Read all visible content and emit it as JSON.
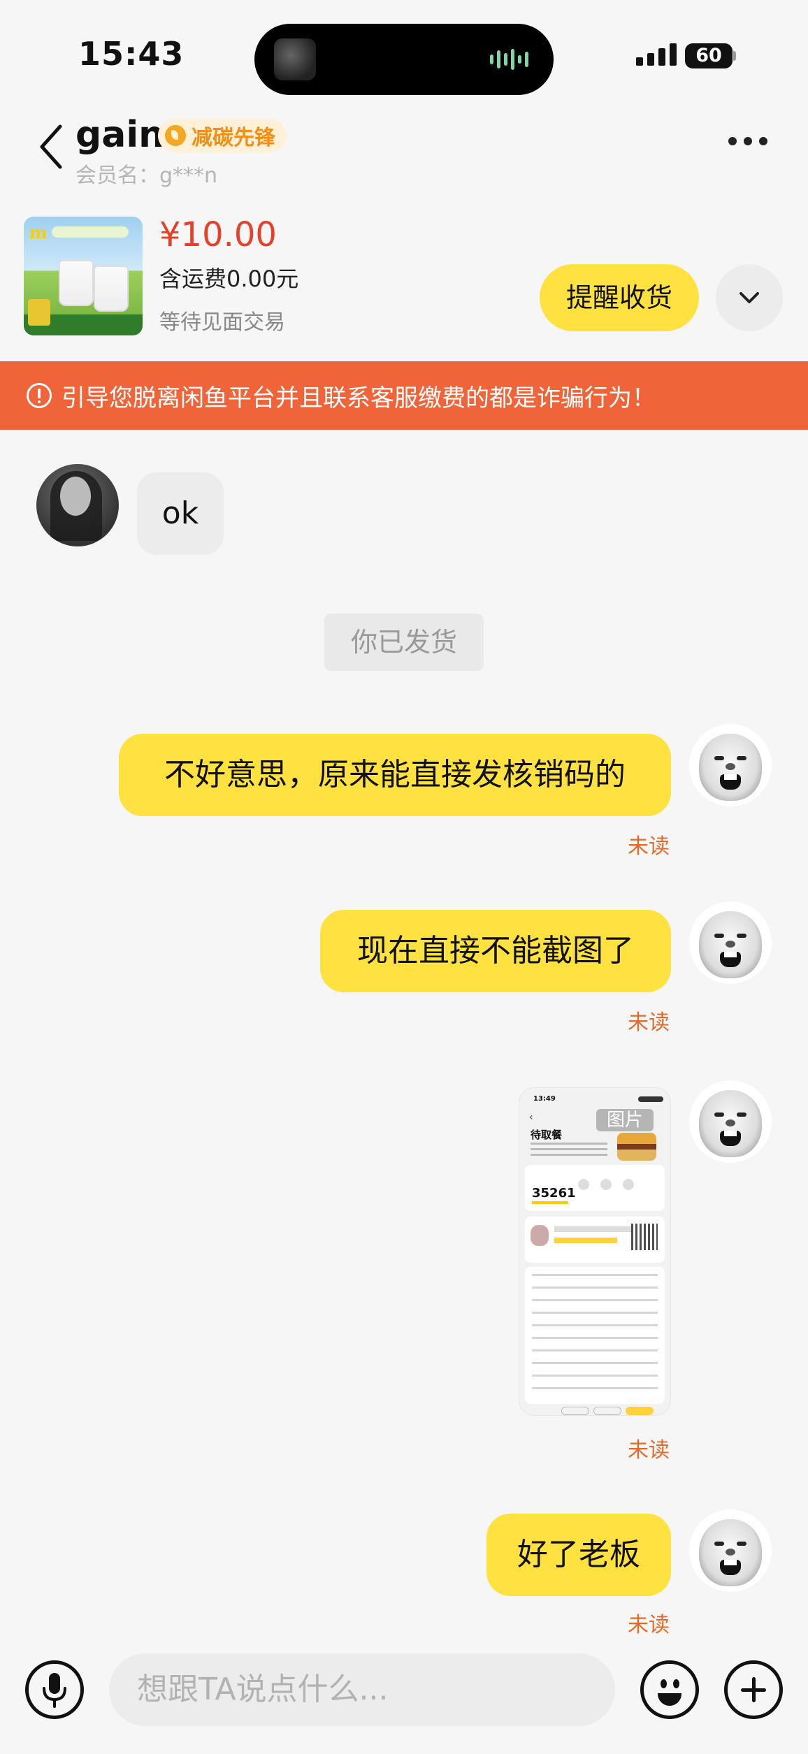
{
  "status_bar": {
    "time": "15:43",
    "battery": "60"
  },
  "header": {
    "title": "gain",
    "badge": "减碳先锋",
    "member_label": "会员名：g***n"
  },
  "product": {
    "price": "¥10.00",
    "shipping": "含运费0.00元",
    "status": "等待见面交易",
    "remind_button": "提醒收货"
  },
  "warning": {
    "text": "引导您脱离闲鱼平台并且联系客服缴费的都是诈骗行为！"
  },
  "messages": {
    "m1": {
      "text": "ok"
    },
    "system": {
      "text": "你已发货"
    },
    "m2": {
      "text": "不好意思，原来能直接发核销码的",
      "status": "未读"
    },
    "m3": {
      "text": "现在直接不能截图了",
      "status": "未读"
    },
    "m4": {
      "image_label": "图片",
      "status": "未读",
      "shot": {
        "time": "13:49",
        "title": "待取餐",
        "code": "35261"
      }
    },
    "m5": {
      "text": "好了老板",
      "status": "未读"
    }
  },
  "input_bar": {
    "placeholder": "想跟TA说点什么..."
  },
  "colors": {
    "accent_yellow": "#ffe23f",
    "warning_orange": "#f0643a",
    "price_red": "#e6402a",
    "unread_orange": "#e46a2a"
  }
}
